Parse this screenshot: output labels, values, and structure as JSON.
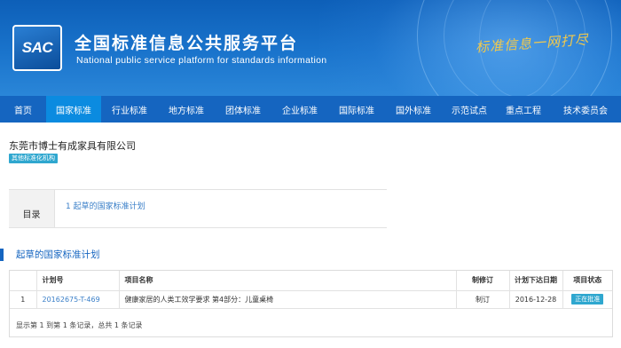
{
  "header": {
    "logo_text": "SAC",
    "title": "全国标准信息公共服务平台",
    "subtitle": "National public service platform  for standards information",
    "slogan": "标准信息一网打尽"
  },
  "nav": {
    "items": [
      {
        "label": "首页"
      },
      {
        "label": "国家标准"
      },
      {
        "label": "行业标准"
      },
      {
        "label": "地方标准"
      },
      {
        "label": "团体标准"
      },
      {
        "label": "企业标准"
      },
      {
        "label": "国际标准"
      },
      {
        "label": "国外标准"
      },
      {
        "label": "示范试点"
      },
      {
        "label": "重点工程"
      },
      {
        "label": "技术委员会"
      }
    ],
    "active_index": 1
  },
  "org": {
    "name": "东莞市博士有成家具有限公司",
    "badge": "其他标准化机构"
  },
  "toc": {
    "label": "目录",
    "items": [
      {
        "label": "1  起草的国家标准计划"
      }
    ]
  },
  "section": {
    "title": "起草的国家标准计划"
  },
  "table": {
    "headers": [
      "",
      "计划号",
      "项目名称",
      "制修订",
      "计划下达日期",
      "项目状态"
    ],
    "rows": [
      {
        "index": "1",
        "plan_no": "20162675-T-469",
        "name": "健康家居的人类工效学要求 第4部分：儿童桌椅",
        "type": "制订",
        "date": "2016-12-28",
        "status": "正在批准"
      }
    ],
    "footer": "显示第 1 到第 1 条记录，总共 1 条记录"
  },
  "colors": {
    "banner": "#1a74cc",
    "nav": "#1565c0",
    "nav_active": "#0b8be0",
    "badge": "#2fa7cf",
    "link": "#3a7fc8"
  }
}
